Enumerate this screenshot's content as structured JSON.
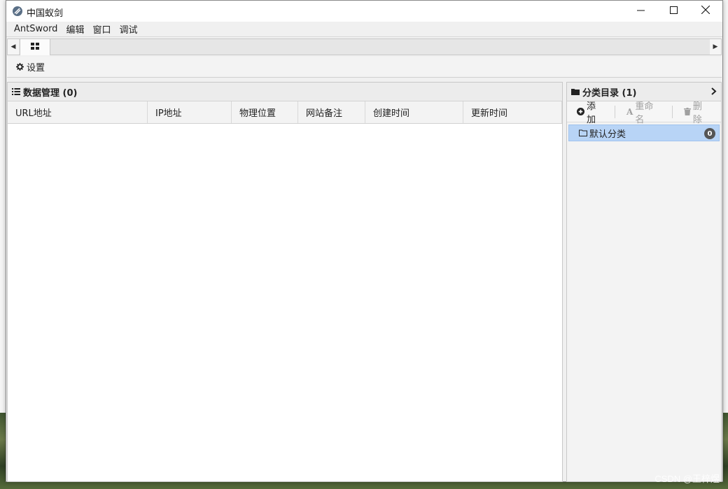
{
  "window": {
    "title": "中国蚁剑",
    "controls": {
      "minimize_icon": "minimize-icon",
      "maximize_icon": "maximize-icon",
      "close_icon": "close-icon"
    }
  },
  "menubar": {
    "items": [
      {
        "label": "AntSword"
      },
      {
        "label": "编辑"
      },
      {
        "label": "窗口"
      },
      {
        "label": "调试"
      }
    ]
  },
  "tabs": {
    "left_arrow": "◀",
    "right_arrow": "▶",
    "home_icon": "grid-icon"
  },
  "toolbar": {
    "settings_label": "设置"
  },
  "data_panel": {
    "title": "数据管理 (0)",
    "columns": [
      {
        "label": "URL地址"
      },
      {
        "label": "IP地址"
      },
      {
        "label": "物理位置"
      },
      {
        "label": "网站备注"
      },
      {
        "label": "创建时间"
      },
      {
        "label": "更新时间"
      }
    ],
    "rows": []
  },
  "category_panel": {
    "title": "分类目录 (1)",
    "add_label": "添加",
    "rename_label": "重命名",
    "delete_label": "删除",
    "items": [
      {
        "label": "默认分类",
        "count": "0"
      }
    ]
  },
  "watermark": "CSDN @王梓煜",
  "colors": {
    "selection": "#b8d4f6",
    "badge": "#555555"
  }
}
